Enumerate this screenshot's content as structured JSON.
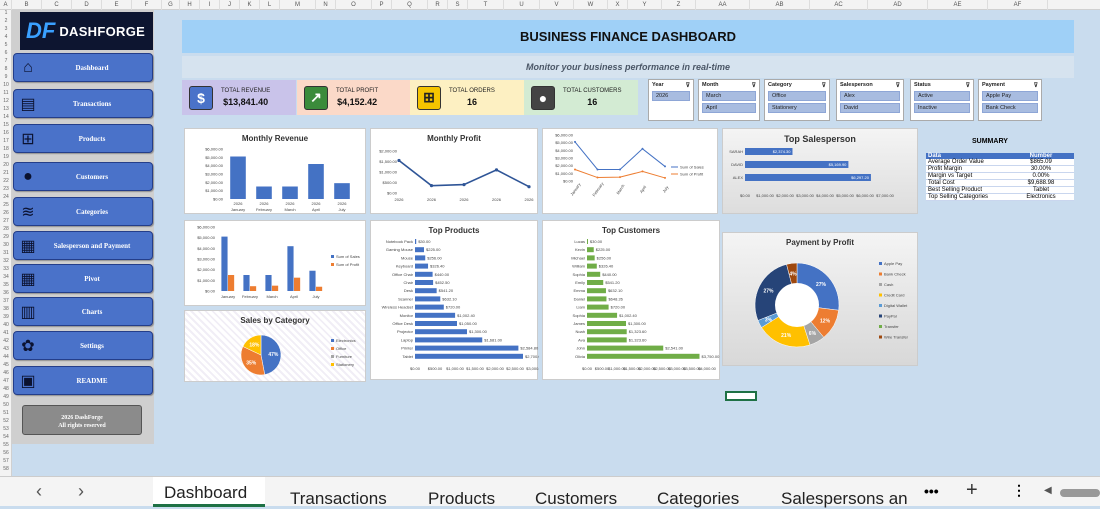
{
  "columns": [
    "A",
    "B",
    "C",
    "D",
    "E",
    "F",
    "G",
    "H",
    "I",
    "J",
    "K",
    "L",
    "M",
    "N",
    "O",
    "P",
    "Q",
    "R",
    "S",
    "T",
    "U",
    "V",
    "W",
    "X",
    "Y",
    "Z",
    "AA",
    "AB",
    "AC",
    "AD",
    "AE",
    "AF"
  ],
  "brand": {
    "mark": "DF",
    "name": "DashForge"
  },
  "sidebar": [
    {
      "label": "Dashboard",
      "icon": "home-icon"
    },
    {
      "label": "Transactions",
      "icon": "document-icon"
    },
    {
      "label": "Products",
      "icon": "cart-icon"
    },
    {
      "label": "Customers",
      "icon": "person-icon"
    },
    {
      "label": "Categories",
      "icon": "stack-icon"
    },
    {
      "label": "Salesperson and Payment",
      "icon": "cash-icon"
    },
    {
      "label": "Pivot",
      "icon": "calendar-icon"
    },
    {
      "label": "Charts",
      "icon": "bar-chart-icon"
    },
    {
      "label": "Settings",
      "icon": "gear-icon"
    },
    {
      "label": "README",
      "icon": "chat-icon"
    }
  ],
  "copyright": {
    "line1": "2026 DashForge",
    "line2": "All rights reserved"
  },
  "header": {
    "title": "BUSINESS FINANCE DASHBOARD",
    "subtitle": "Monitor your business performance in real-time"
  },
  "kpis": [
    {
      "label": "TOTAL REVENUE",
      "value": "$13,841.40",
      "icon": "dollar-icon",
      "bg": "#c9c3ea",
      "ic": "#4a72c9"
    },
    {
      "label": "TOTAL PROFIT",
      "value": "$4,152.42",
      "icon": "trend-icon",
      "bg": "#fbd9c8",
      "ic": "#3b8b3b"
    },
    {
      "label": "TOTAL ORDERS",
      "value": "16",
      "icon": "cart-icon",
      "bg": "#fdf0c2",
      "ic": "#f5c400"
    },
    {
      "label": "TOTAL CUSTOMERS",
      "value": "16",
      "icon": "person-icon",
      "bg": "#d3ebd3",
      "ic": "#444"
    }
  ],
  "slicers": [
    {
      "title": "Year",
      "items": [
        "2026"
      ]
    },
    {
      "title": "Month",
      "items": [
        "March",
        "April"
      ]
    },
    {
      "title": "Category",
      "items": [
        "Office",
        "Stationery"
      ]
    },
    {
      "title": "Salesperson",
      "items": [
        "Alex",
        "David"
      ]
    },
    {
      "title": "Status",
      "items": [
        "Active",
        "Inactive"
      ]
    },
    {
      "title": "Payment",
      "items": [
        "Apple Pay",
        "Bank Check"
      ]
    }
  ],
  "chart_data": [
    {
      "type": "bar",
      "title": "Monthly Revenue",
      "categories": [
        "January",
        "February",
        "March",
        "April",
        "July"
      ],
      "values": [
        5100,
        1500,
        1500,
        4200,
        1900
      ],
      "ylim": [
        0,
        6000
      ],
      "yticks": [
        "$6,000.00",
        "$5,000.00",
        "$4,000.00",
        "$3,000.00",
        "$2,000.00",
        "$1,000.00",
        "$0.00"
      ],
      "year": "2026"
    },
    {
      "type": "line",
      "title": "Monthly Profit",
      "categories": [
        "2026",
        "2026",
        "2026",
        "2026",
        "2026"
      ],
      "values": [
        1550,
        350,
        400,
        1100,
        300
      ],
      "ylim": [
        0,
        2000
      ],
      "yticks": [
        "$2,000.00",
        "$1,500.00",
        "$1,000.00",
        "$500.00",
        "$0.00"
      ]
    },
    {
      "type": "line",
      "title": "",
      "categories": [
        "January",
        "February",
        "March",
        "April",
        "July"
      ],
      "series": [
        {
          "name": "Sum of Sales",
          "values": [
            5100,
            1500,
            1500,
            4200,
            1900
          ]
        },
        {
          "name": "Sum of Profit",
          "values": [
            1500,
            450,
            500,
            1250,
            400
          ]
        }
      ],
      "ylim": [
        0,
        6000
      ],
      "yticks": [
        "$6,000.00",
        "$5,000.00",
        "$4,000.00",
        "$3,000.00",
        "$2,000.00",
        "$1,000.00",
        "$0.00"
      ]
    },
    {
      "type": "bar",
      "title": "Top Salesperson",
      "categories": [
        "SARAH",
        "DAVID",
        "ALEX"
      ],
      "values": [
        2374.3,
        5169.9,
        6297.2
      ],
      "labels": [
        "$2,374.30",
        "$5,169.90",
        "$6,297.20"
      ],
      "xticks": [
        "$0.00",
        "$1,000.00",
        "$2,000.00",
        "$3,000.00",
        "$4,000.00",
        "$5,000.00",
        "$6,000.00",
        "$7,000.00"
      ],
      "xlim": [
        0,
        7000
      ]
    },
    {
      "type": "bar",
      "title": "",
      "categories": [
        "January",
        "February",
        "March",
        "April",
        "July"
      ],
      "series": [
        {
          "name": "Sum of Sales",
          "values": [
            5100,
            1500,
            1500,
            4200,
            1900
          ]
        },
        {
          "name": "Sum of Profit",
          "values": [
            1500,
            450,
            500,
            1250,
            400
          ]
        }
      ],
      "ylim": [
        0,
        6000
      ],
      "yticks": [
        "$6,000.00",
        "$5,000.00",
        "$4,000.00",
        "$3,000.00",
        "$2,000.00",
        "$1,000.00",
        "$0.00"
      ]
    },
    {
      "type": "bar",
      "title": "Top Products",
      "categories": [
        "Notebook Pack",
        "Gaming Mouse",
        "Mouse",
        "Keyboard",
        "Office Chair",
        "Chair",
        "Desk",
        "Scanner",
        "Wireless Headset",
        "Monitor",
        "Office Desk",
        "Projector",
        "Laptop",
        "Printer",
        "Tablet"
      ],
      "values": [
        30,
        225,
        256,
        326.4,
        440,
        452.5,
        541.2,
        632.1,
        720,
        1002.4,
        1050,
        1300,
        1681,
        2584.8,
        2700
      ],
      "labels": [
        "$30.00",
        "$225.00",
        "$256.00",
        "$326.40",
        "$440.00",
        "$452.50",
        "$541.20",
        "$632.10",
        "$720.00",
        "$1,002.40",
        "$1,050.00",
        "$1,300.00",
        "$1,681.00",
        "$2,584.80",
        "$2,700.00"
      ],
      "xticks": [
        "$0.00",
        "$500.00",
        "$1,000.00",
        "$1,500.00",
        "$2,000.00",
        "$2,500.00",
        "$3,000.00"
      ],
      "xlim": [
        0,
        3000
      ]
    },
    {
      "type": "bar",
      "title": "Top Customers",
      "categories": [
        "Lucas",
        "Kevin",
        "Michael",
        "William",
        "Sophia",
        "Emily",
        "Emma",
        "Daniel",
        "Liam",
        "Sophia",
        "James",
        "Noah",
        "Ava",
        "John",
        "Olivia"
      ],
      "values": [
        30,
        225,
        256,
        326.4,
        440,
        541.2,
        632.1,
        648.26,
        720,
        1002.4,
        1300,
        1323.6,
        1323.6,
        2541,
        3750
      ],
      "labels": [
        "$30.00",
        "$225.00",
        "$256.00",
        "$326.40",
        "$440.00",
        "$541.20",
        "$632.10",
        "$648.26",
        "$720.00",
        "$1,002.40",
        "$1,300.00",
        "$1,323.60",
        "$1,323.60",
        "$2,541.00",
        "$3,750.00"
      ],
      "xticks": [
        "$0.00",
        "$500.00",
        "$1,000.00",
        "$1,500.00",
        "$2,000.00",
        "$2,500.00",
        "$3,000.00",
        "$3,500.00",
        "$4,000.00"
      ],
      "xlim": [
        0,
        4000
      ]
    },
    {
      "type": "pie",
      "title": "Sales by Category",
      "slices": [
        {
          "name": "Electronics",
          "value": 47,
          "color": "#4472c4"
        },
        {
          "name": "Office",
          "value": 35,
          "color": "#ed7d31"
        },
        {
          "name": "Furniture",
          "value": 0,
          "color": "#a5a5a5"
        },
        {
          "name": "Stationery",
          "value": 18,
          "color": "#ffc000"
        }
      ],
      "labels": [
        "47%",
        "35%",
        "18%"
      ]
    },
    {
      "type": "pie",
      "title": "Payment by Profit",
      "slices": [
        {
          "name": "Apple Pay",
          "value": 27,
          "color": "#4472c4"
        },
        {
          "name": "Bank Check",
          "value": 12,
          "color": "#ed7d31"
        },
        {
          "name": "Cash",
          "value": 6,
          "color": "#a5a5a5"
        },
        {
          "name": "Credit Card",
          "value": 21,
          "color": "#ffc000"
        },
        {
          "name": "Digital Wallet",
          "value": 3,
          "color": "#5b9bd5"
        },
        {
          "name": "PayPal",
          "value": 27,
          "color": "#264478"
        },
        {
          "name": "Transfer",
          "value": 0,
          "color": "#70ad47"
        },
        {
          "name": "Wire Transfer",
          "value": 4,
          "color": "#9e480e"
        }
      ],
      "labels": [
        "27%",
        "12%",
        "6%",
        "21%",
        "3%",
        "27%",
        "4%"
      ]
    }
  ],
  "summary": {
    "title": "SUMMARY",
    "headers": [
      "Data",
      "Number"
    ],
    "rows": [
      [
        "Average Order Value",
        "$865.09"
      ],
      [
        "Profit Margin",
        "30.00%"
      ],
      [
        "Margin vs Target",
        "0.00%"
      ],
      [
        "Total Cost",
        "$9,688.98"
      ],
      [
        "Best Selling Product",
        "Tablet"
      ],
      [
        "Top Selling Categories",
        "Electronics"
      ]
    ]
  },
  "tabs": [
    "Dashboard",
    "Transactions",
    "Products",
    "Customers",
    "Categories",
    "Salespersons an"
  ]
}
